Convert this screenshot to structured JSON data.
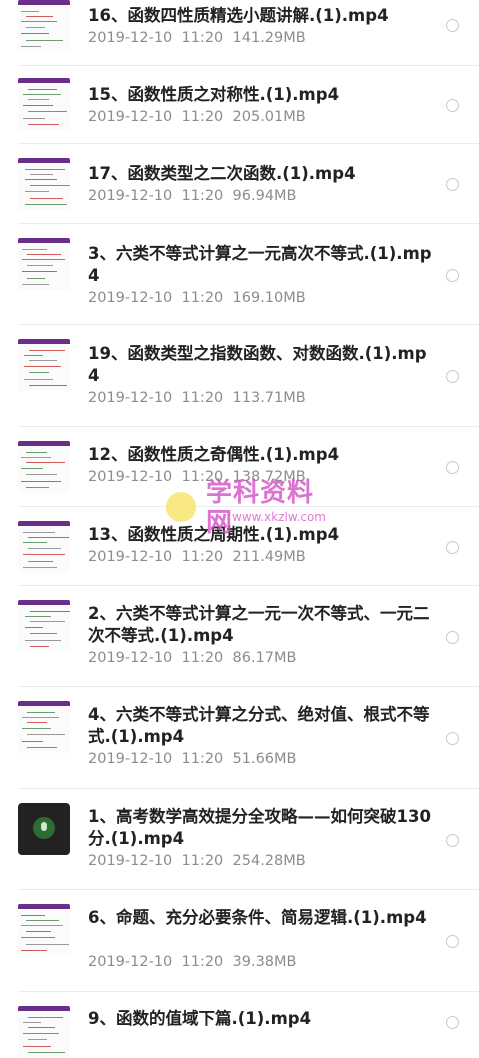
{
  "files": [
    {
      "title": "16、函数四性质精选小题讲解.(1).mp4",
      "date": "2019-12-10",
      "time": "11:20",
      "size": "141.29MB",
      "thumb": "video"
    },
    {
      "title": "15、函数性质之对称性.(1).mp4",
      "date": "2019-12-10",
      "time": "11:20",
      "size": "205.01MB",
      "thumb": "video"
    },
    {
      "title": "17、函数类型之二次函数.(1).mp4",
      "date": "2019-12-10",
      "time": "11:20",
      "size": "96.94MB",
      "thumb": "video"
    },
    {
      "title": "3、六类不等式计算之一元高次不等式.(1).mp4",
      "date": "2019-12-10",
      "time": "11:20",
      "size": "169.10MB",
      "thumb": "video"
    },
    {
      "title": "19、函数类型之指数函数、对数函数.(1).mp4",
      "date": "2019-12-10",
      "time": "11:20",
      "size": "113.71MB",
      "thumb": "video"
    },
    {
      "title": "12、函数性质之奇偶性.(1).mp4",
      "date": "2019-12-10",
      "time": "11:20",
      "size": "138.72MB",
      "thumb": "video"
    },
    {
      "title": "13、函数性质之周期性.(1).mp4",
      "date": "2019-12-10",
      "time": "11:20",
      "size": "211.49MB",
      "thumb": "video"
    },
    {
      "title": "2、六类不等式计算之一元一次不等式、一元二次不等式.(1).mp4",
      "date": "2019-12-10",
      "time": "11:20",
      "size": "86.17MB",
      "thumb": "video"
    },
    {
      "title": "4、六类不等式计算之分式、绝对值、根式不等式.(1).mp4",
      "date": "2019-12-10",
      "time": "11:20",
      "size": "51.66MB",
      "thumb": "video"
    },
    {
      "title": "1、高考数学高效提分全攻略——如何突破130分.(1).mp4",
      "date": "2019-12-10",
      "time": "11:20",
      "size": "254.28MB",
      "thumb": "audio"
    },
    {
      "title": "6、命题、充分必要条件、简易逻辑.(1).mp4",
      "date": "2019-12-10",
      "time": "11:20",
      "size": "39.38MB",
      "thumb": "video"
    },
    {
      "title": "9、函数的值域下篇.(1).mp4",
      "date": "",
      "time": "",
      "size": "",
      "thumb": "video"
    }
  ],
  "watermark": {
    "main": "学科资料网",
    "sub": "www.xkzlw.com"
  },
  "icons": {
    "select": "radio-circle-icon",
    "audio": "microphone-icon"
  }
}
